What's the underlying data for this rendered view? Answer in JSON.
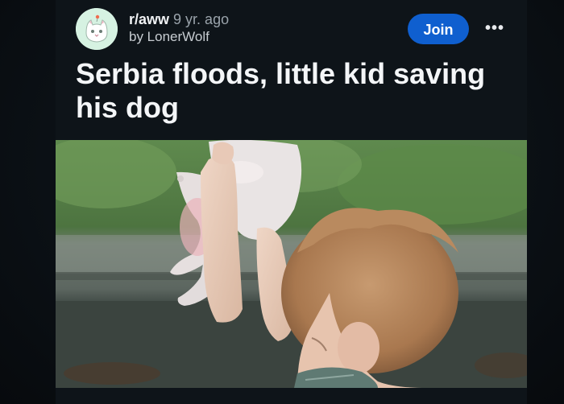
{
  "post": {
    "subreddit": "r/aww",
    "separator": "",
    "age": "9 yr. ago",
    "author_line": "by LonerWolf",
    "title": "Serbia floods, little kid saving his dog"
  },
  "actions": {
    "join_label": "Join",
    "more_label": "•••"
  },
  "icons": {
    "avatar": "subreddit-avatar-cat-icon",
    "more": "more-options-icon"
  },
  "colors": {
    "join_button": "#0f5fcf",
    "background": "#0e1419",
    "title_text": "#f4f6f8"
  }
}
